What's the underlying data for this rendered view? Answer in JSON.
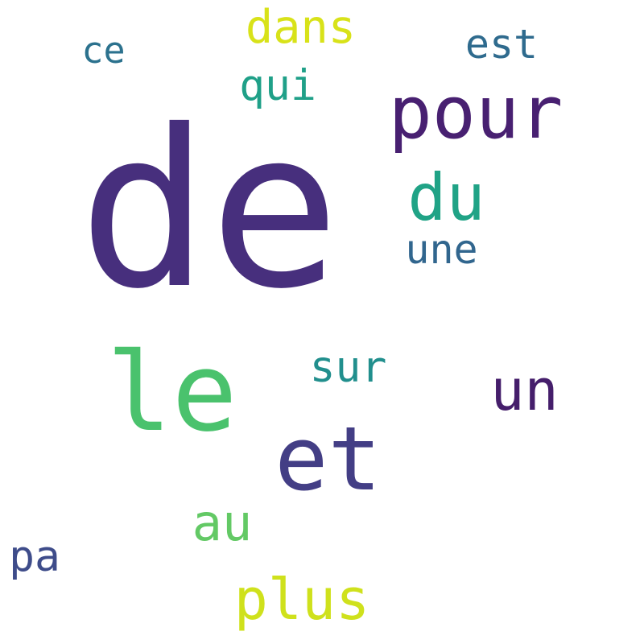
{
  "words": [
    {
      "id": "de",
      "text": "de",
      "color": "#472f7d"
    },
    {
      "id": "pour",
      "text": "pour",
      "color": "#482071"
    },
    {
      "id": "le",
      "text": "le",
      "color": "#4ac26d"
    },
    {
      "id": "un",
      "text": "un",
      "color": "#451e6b"
    },
    {
      "id": "et",
      "text": "et",
      "color": "#433e85"
    },
    {
      "id": "du",
      "text": "du",
      "color": "#20a386"
    },
    {
      "id": "une",
      "text": "une",
      "color": "#31668e"
    },
    {
      "id": "sur",
      "text": "sur",
      "color": "#218f8d"
    },
    {
      "id": "au",
      "text": "au",
      "color": "#63c965"
    },
    {
      "id": "plus",
      "text": "plus",
      "color": "#cfe11c"
    },
    {
      "id": "dans",
      "text": "dans",
      "color": "#d8e219"
    },
    {
      "id": "est",
      "text": "est",
      "color": "#2f6b8e"
    },
    {
      "id": "qui",
      "text": "qui",
      "color": "#1fa088"
    },
    {
      "id": "ce",
      "text": "ce",
      "color": "#2c728e"
    },
    {
      "id": "pa",
      "text": "pa",
      "color": "#3e4c8a"
    }
  ]
}
